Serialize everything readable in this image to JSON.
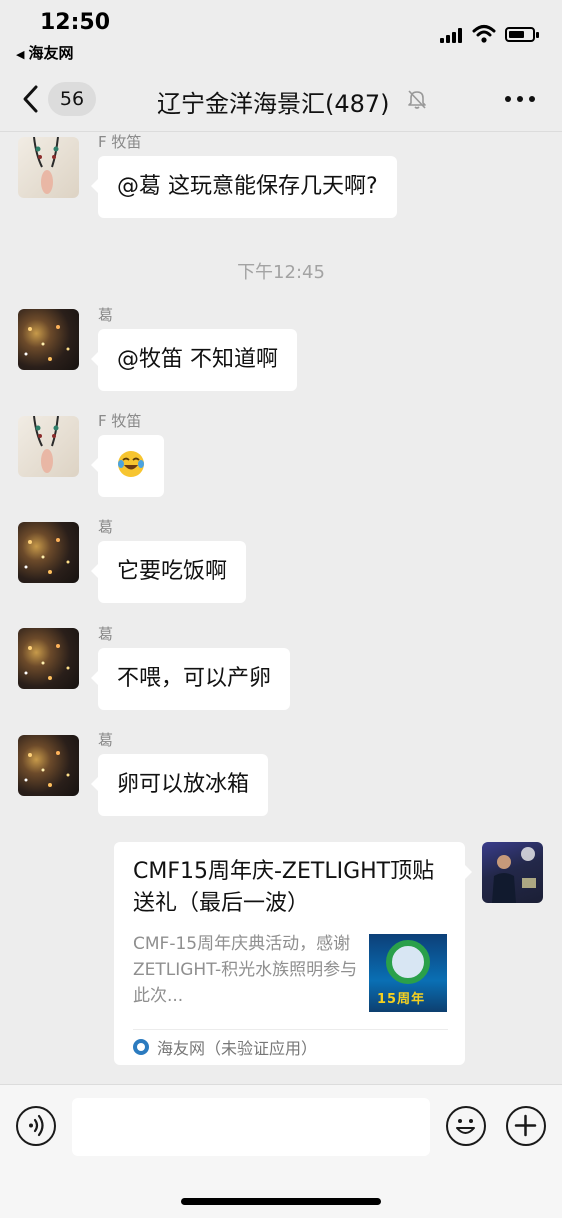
{
  "status_bar": {
    "time": "12:50",
    "back_app": "海友网",
    "back_glyph": "◀"
  },
  "nav": {
    "unread_count": "56",
    "title": "辽宁金洋海景汇(487)",
    "muted": true
  },
  "messages": [
    {
      "sender": "F 牧笛",
      "avatar": "flute-avatar",
      "text": "@葛 这玩意能保存几天啊?"
    },
    {
      "timestamp": "下午12:45"
    },
    {
      "sender": "葛",
      "avatar": "city-night-avatar",
      "text": "@牧笛 不知道啊"
    },
    {
      "sender": "F 牧笛",
      "avatar": "flute-avatar",
      "emoji": "laughing-crying-emoji"
    },
    {
      "sender": "葛",
      "avatar": "city-night-avatar",
      "text": "它要吃饭啊"
    },
    {
      "sender": "葛",
      "avatar": "city-night-avatar",
      "text": "不喂，可以产卵"
    },
    {
      "sender": "葛",
      "avatar": "city-night-avatar",
      "text": "卵可以放冰箱"
    }
  ],
  "card": {
    "title": "CMF15周年庆-ZETLIGHT顶贴送礼（最后一波）",
    "description": "CMF-15周年庆典活动，感谢 ZETLIGHT-积光水族照明参与此次...",
    "thumb_text": "15周年",
    "source": "海友网（未验证应用）"
  },
  "input_bar": {
    "voice_icon": "voice-icon",
    "emoji_icon": "emoji-icon",
    "plus_icon": "plus-icon",
    "placeholder": ""
  },
  "colors": {
    "background": "#ededed",
    "bubble": "#ffffff",
    "meta_text": "#8a8a8a"
  }
}
